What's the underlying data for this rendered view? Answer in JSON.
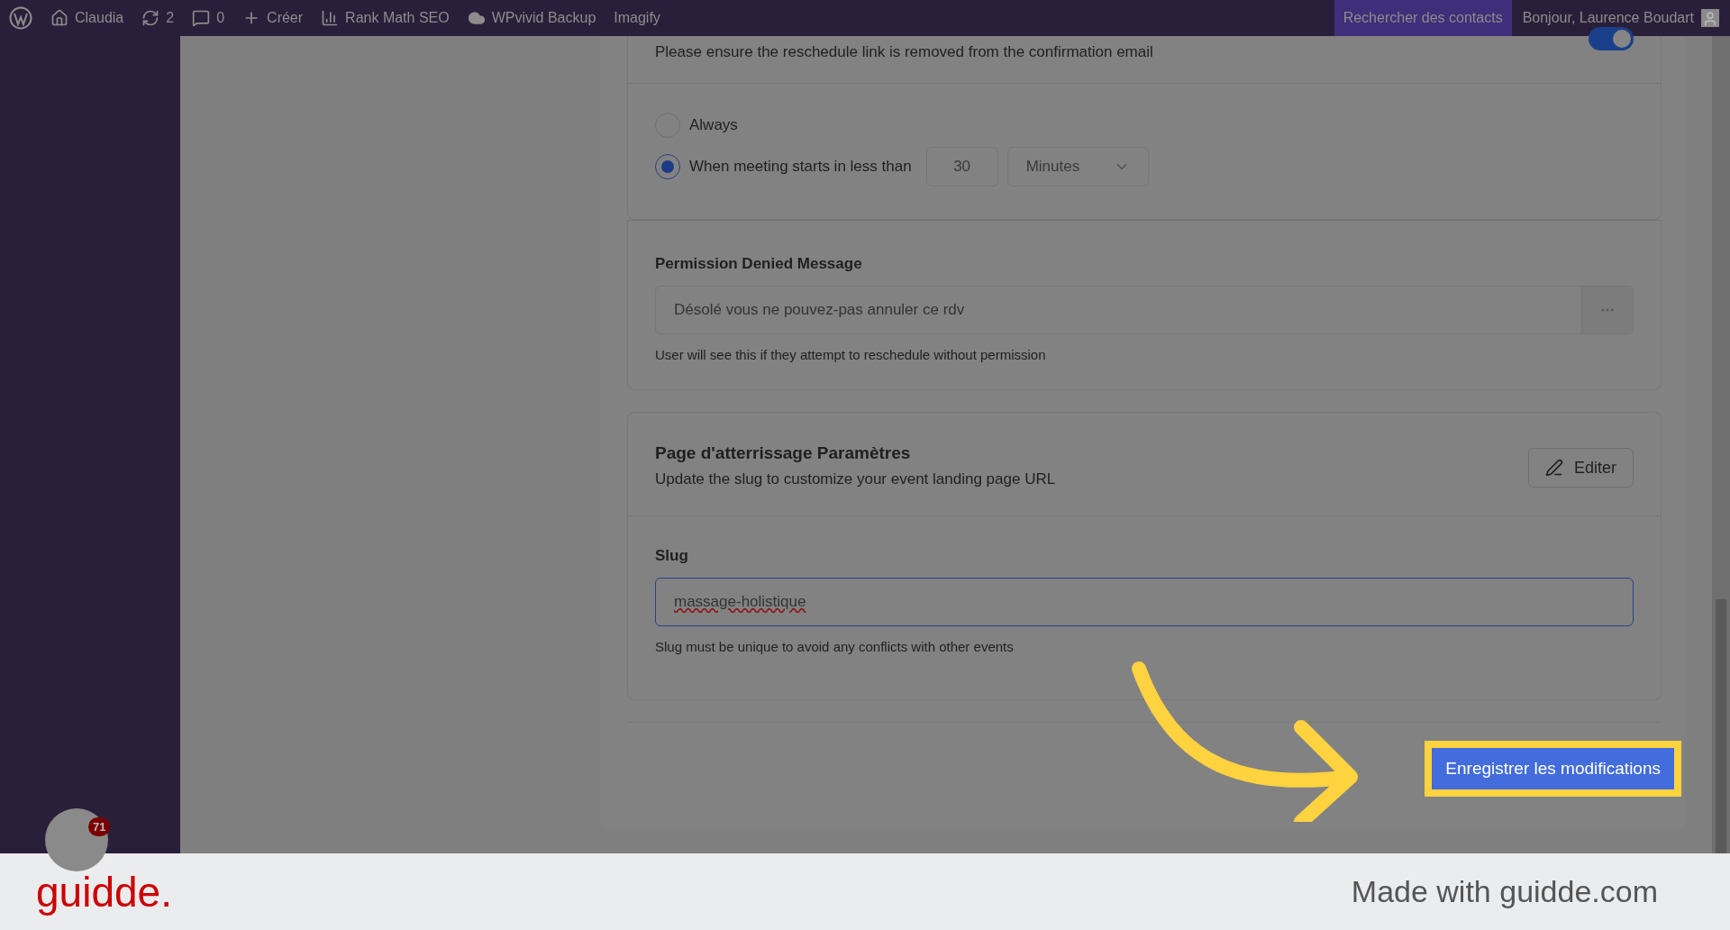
{
  "admin_bar": {
    "items": [
      {
        "kind": "logo"
      },
      {
        "kind": "home",
        "label": "Claudia"
      },
      {
        "kind": "updates",
        "label": "2"
      },
      {
        "kind": "comments",
        "label": "0"
      },
      {
        "kind": "new",
        "label": "Créer"
      },
      {
        "kind": "chart",
        "label": "Rank Math SEO"
      },
      {
        "kind": "cloud",
        "label": "WPvivid Backup"
      },
      {
        "kind": "plain",
        "label": "Imagify"
      }
    ],
    "search_contacts": "Rechercher des contacts",
    "greeting": "Bonjour, Laurence Boudart"
  },
  "sidebar": {
    "notification_badge": "71"
  },
  "reschedule": {
    "toggle_on": true,
    "note": "Please ensure the reschedule link is removed from the confirmation email",
    "options": [
      {
        "label": "Always",
        "selected": false
      },
      {
        "label": "When meeting starts in less than",
        "selected": true,
        "amount": "30",
        "unit": "Minutes"
      }
    ]
  },
  "permission": {
    "title": "Permission Denied Message",
    "value": "Désolé vous ne pouvez-pas annuler ce rdv",
    "help": "User will see this if they attempt to reschedule without permission"
  },
  "landing": {
    "title": "Page d'atterrissage Paramètres",
    "subtitle": "Update the slug to customize your event landing page URL",
    "edit_button": "Editer",
    "slug": {
      "label": "Slug",
      "value": "massage-holistique",
      "help": "Slug must be unique to avoid any conflicts with other events"
    }
  },
  "save_button": "Enregistrer les modifications",
  "footer": {
    "brand": "guidde.",
    "tagline": "Made with guidde.com"
  }
}
